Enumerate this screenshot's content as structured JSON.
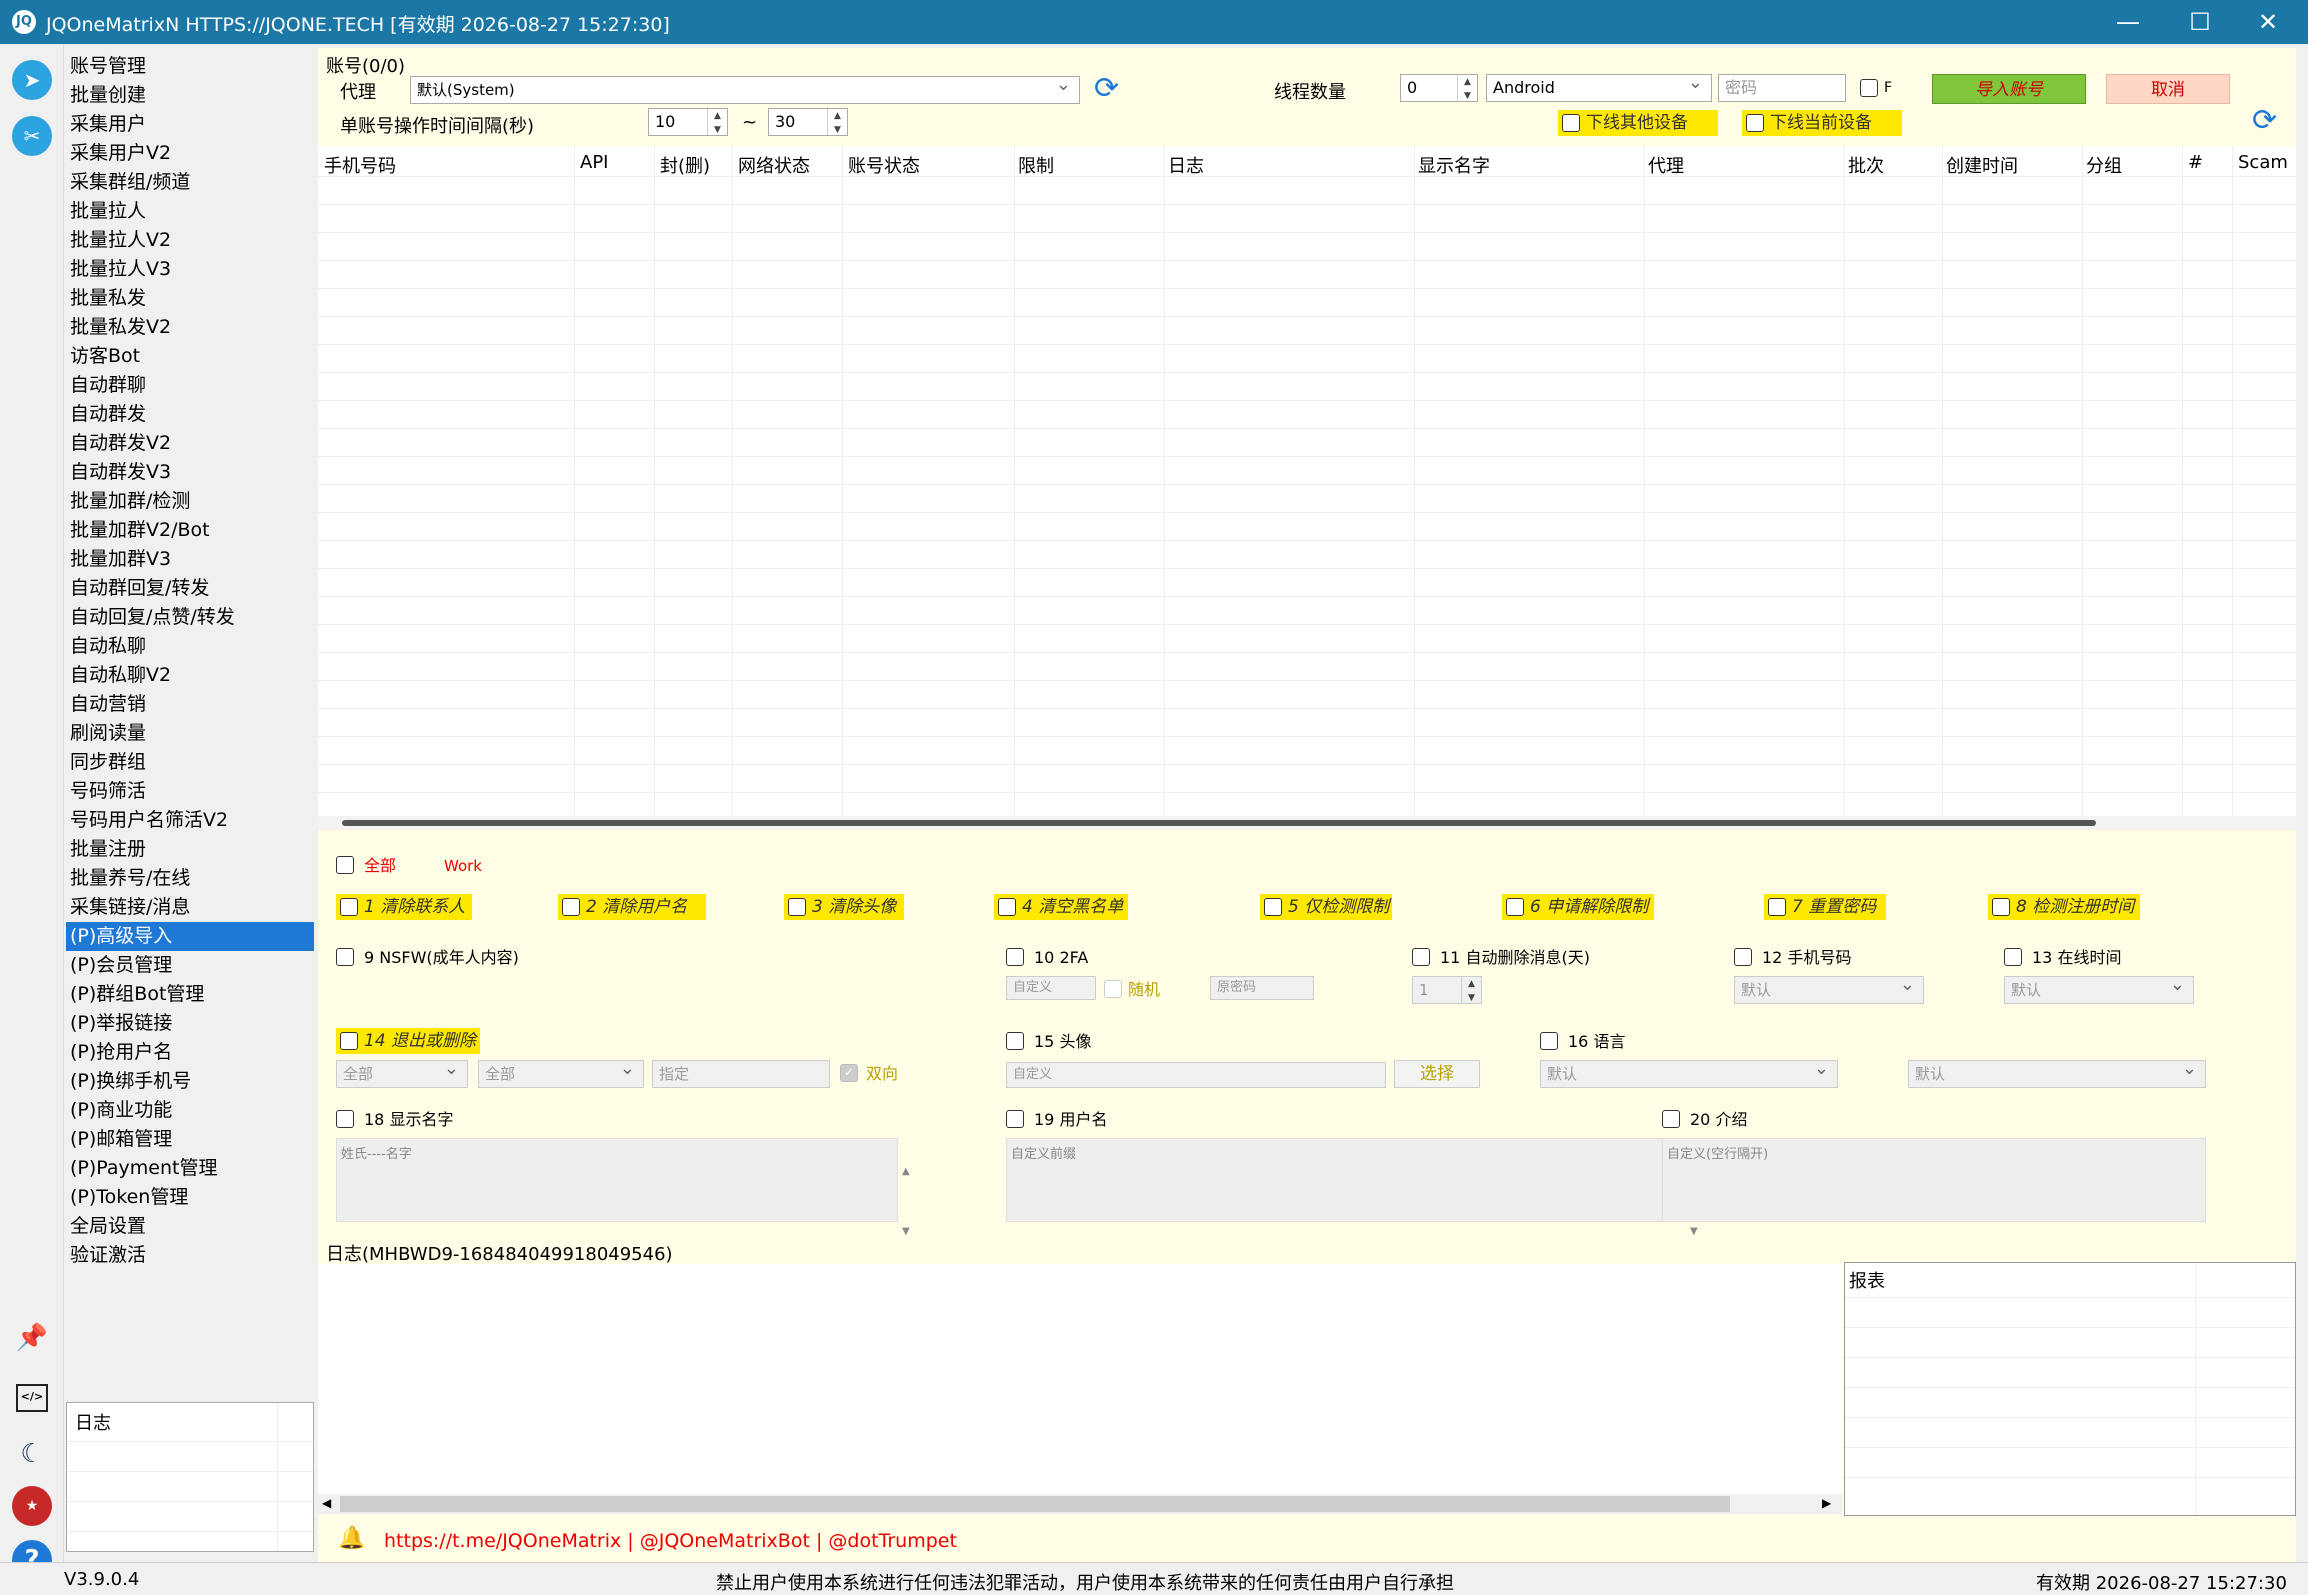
{
  "window": {
    "title": "JQOneMatrixN HTTPS://JQONE.TECH  [有效期 2026-08-27 15:27:30]",
    "minimize": "—",
    "maximize": "☐",
    "close": "✕"
  },
  "sidebar": {
    "items": [
      "账号管理",
      "批量创建",
      "采集用户",
      "采集用户V2",
      "采集群组/频道",
      "批量拉人",
      "批量拉人V2",
      "批量拉人V3",
      "批量私发",
      "批量私发V2",
      "访客Bot",
      "自动群聊",
      "自动群发",
      "自动群发V2",
      "自动群发V3",
      "批量加群/检测",
      "批量加群V2/Bot",
      "批量加群V3",
      "自动群回复/转发",
      "自动回复/点赞/转发",
      "自动私聊",
      "自动私聊V2",
      "自动营销",
      "刷阅读量",
      "同步群组",
      "号码筛活",
      "号码用户名筛活V2",
      "批量注册",
      "批量养号/在线",
      "采集链接/消息",
      "(P)高级导入",
      "(P)会员管理",
      "(P)群组Bot管理",
      "(P)举报链接",
      "(P)抢用户名",
      "(P)换绑手机号",
      "(P)商业功能",
      "(P)邮箱管理",
      "(P)Payment管理",
      "(P)Token管理",
      "全局设置",
      "验证激活"
    ],
    "selected_index": 30,
    "log_title": "日志"
  },
  "top": {
    "section_title": "账号(0/0)",
    "proxy_label": "代理",
    "proxy_value": "默认(System)",
    "thread_label": "线程数量",
    "thread_value": "0",
    "device_value": "Android",
    "password_placeholder": "密码",
    "f_label": "F",
    "import_button": "导入账号",
    "cancel_button": "取消",
    "interval_label": "单账号操作时间间隔(秒)",
    "interval_min": "10",
    "interval_sep": "~",
    "interval_max": "30",
    "offline_other": "下线其他设备",
    "offline_current": "下线当前设备"
  },
  "table": {
    "columns": [
      "手机号码",
      "API",
      "封(删)",
      "网络状态",
      "账号状态",
      "限制",
      "日志",
      "显示名字",
      "代理",
      "批次",
      "创建时间",
      "分组",
      "#",
      "Scam"
    ]
  },
  "options": {
    "all_label": "全部",
    "work_label": "Work",
    "row1": [
      "1 清除联系人",
      "2 清除用户名",
      "3 清除头像",
      "4 清空黑名单",
      "5 仅检测限制",
      "6 申请解除限制",
      "7 重置密码",
      "8 检测注册时间"
    ],
    "nsfw": "9 NSFW(成年人内容)",
    "twofa": "10 2FA",
    "twofa_custom": "自定义",
    "random_label": "随机",
    "orig_password": "原密码",
    "auto_delete": "11 自动删除消息(天)",
    "auto_delete_value": "1",
    "phone": "12 手机号码",
    "phone_value": "默认",
    "online_time": "13 在线时间",
    "online_value": "默认",
    "logout_delete": "14 退出或删除",
    "sel_all_1": "全部",
    "sel_all_2": "全部",
    "specify": "指定",
    "twoway": "双向",
    "avatar": "15 头像",
    "avatar_custom": "自定义",
    "choose_button": "选择",
    "language": "16 语言",
    "lang_value_1": "默认",
    "lang_value_2": "默认",
    "display_name": "18 显示名字",
    "display_name_placeholder": "姓氏----名字",
    "username": "19 用户名",
    "username_placeholder": "自定义前缀",
    "bio": "20 介绍",
    "bio_placeholder": "自定义(空行隔开)"
  },
  "log": {
    "title": "日志(MHBWD9-168484049918049546)",
    "report_title": "报表",
    "links": "https://t.me/JQOneMatrix | @JQOneMatrixBot | @dotTrumpet"
  },
  "status": {
    "version": "V3.9.0.4",
    "notice": "禁止用户使用本系统进行任何违法犯罪活动，用户使用本系统带来的任何责任由用户自行承担",
    "expiry": "有效期 2026-08-27 15:27:30"
  },
  "colors": {
    "titlebar": "#1b78a6",
    "accent": "#1e78d6",
    "highlight": "#ffe800",
    "import": "#7fc63a",
    "cancel": "#ffd7c4"
  },
  "icons": [
    "telegram-icon",
    "tools-icon",
    "pin-icon",
    "code-icon",
    "moon-icon",
    "flag-icon",
    "help-icon",
    "refresh-icon",
    "bell-icon"
  ]
}
